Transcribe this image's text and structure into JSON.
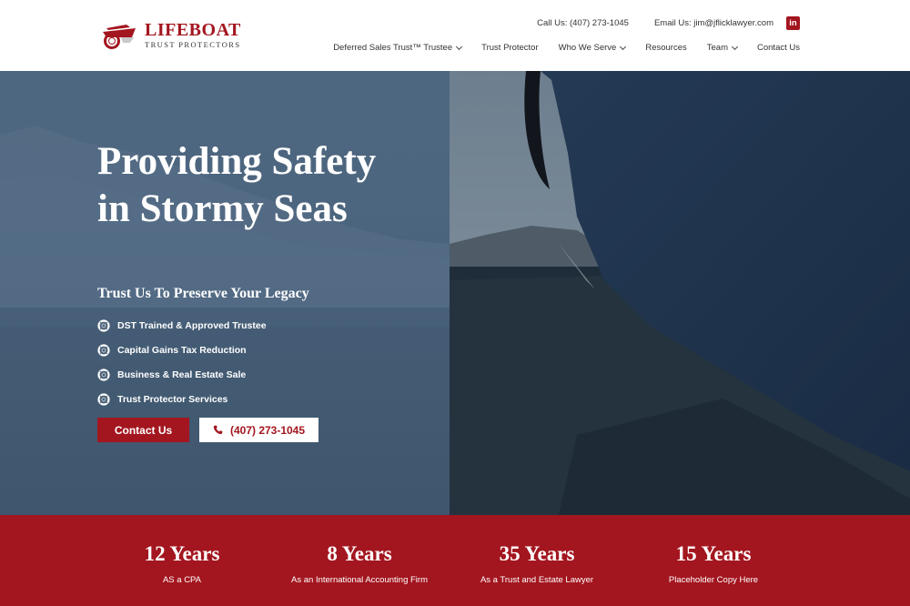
{
  "brand": {
    "name": "LIFEBOAT",
    "tagline": "TRUST PROTECTORS",
    "color": "#a3161f"
  },
  "header": {
    "call": "Call Us: (407) 273-1045",
    "email": "Email Us: jim@jflicklawyer.com",
    "social_icon": "linkedin-icon",
    "social_glyph": "in"
  },
  "nav": {
    "items": [
      {
        "label": "Deferred Sales Trust™ Trustee",
        "dropdown": true
      },
      {
        "label": "Trust Protector",
        "dropdown": false
      },
      {
        "label": "Who We Serve",
        "dropdown": true
      },
      {
        "label": "Resources",
        "dropdown": false
      },
      {
        "label": "Team",
        "dropdown": true
      },
      {
        "label": "Contact Us",
        "dropdown": false
      }
    ]
  },
  "hero": {
    "title": "Providing Safety in Stormy Seas",
    "subtitle": "Trust Us To Preserve Your Legacy",
    "features": [
      "DST Trained & Approved Trustee",
      "Capital Gains Tax Reduction",
      "Business & Real Estate Sale",
      "Trust Protector Services"
    ],
    "feature_icon": "lifebuoy-icon",
    "cta_primary": "Contact Us",
    "cta_phone": "(407) 273-1045",
    "phone_icon": "phone-icon"
  },
  "stats": [
    {
      "value": "12 Years",
      "label": "AS a CPA"
    },
    {
      "value": "8 Years",
      "label": "As an International Accounting Firm"
    },
    {
      "value": "35 Years",
      "label": "As a Trust and Estate Lawyer"
    },
    {
      "value": "15 Years",
      "label": "Placeholder Copy Here"
    }
  ]
}
